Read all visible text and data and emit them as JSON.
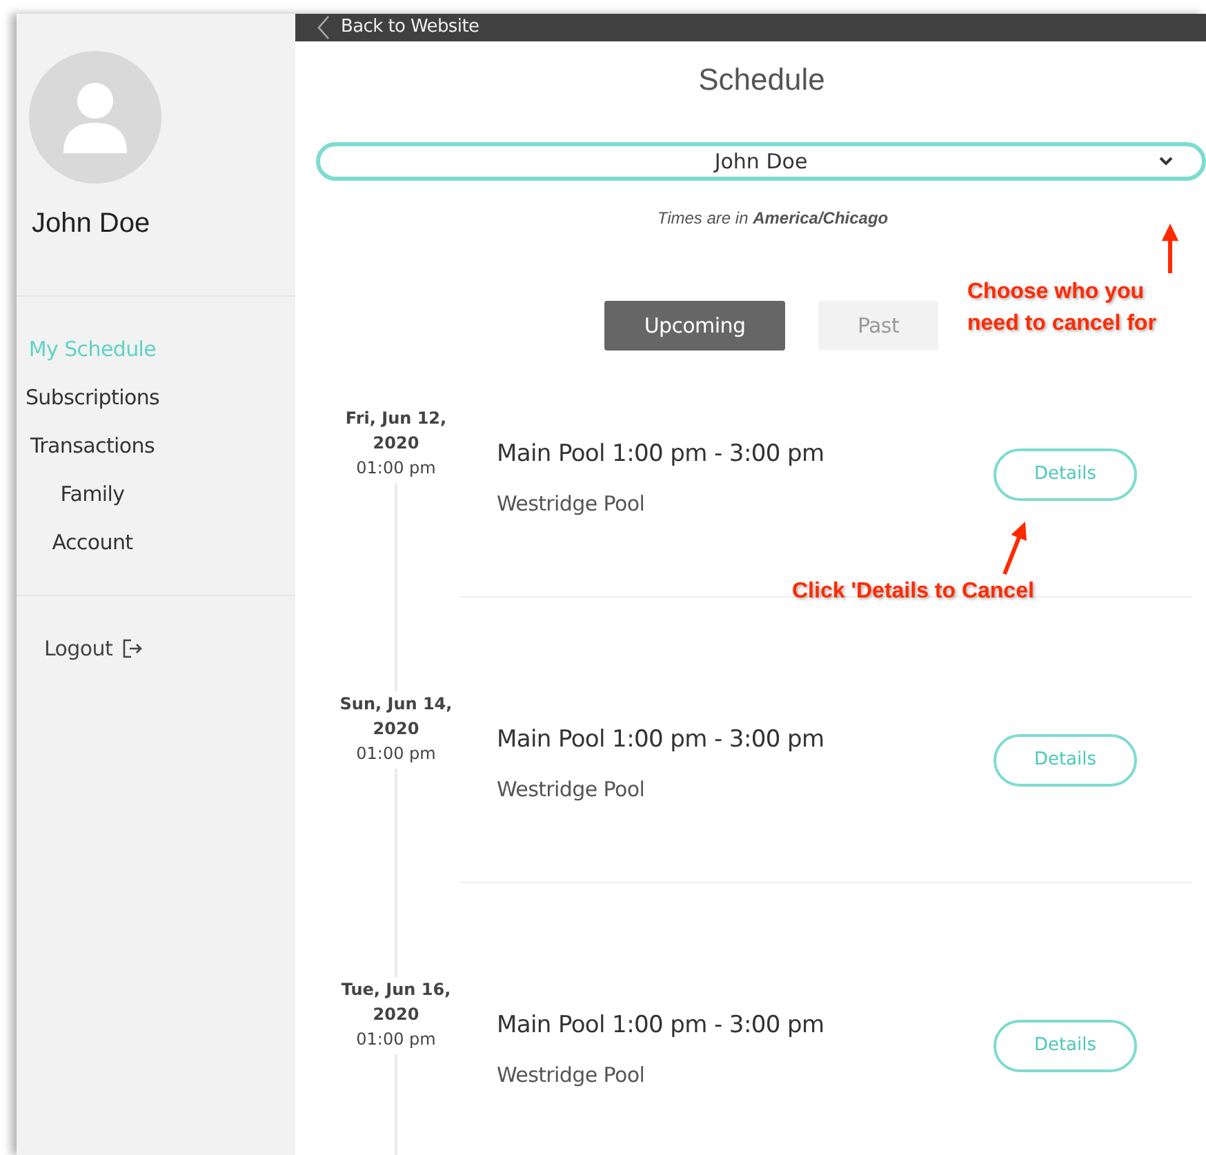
{
  "sidebar": {
    "user_name": "John Doe",
    "items": [
      {
        "label": "My Schedule",
        "selected": true
      },
      {
        "label": "Subscriptions",
        "selected": false
      },
      {
        "label": "Transactions",
        "selected": false
      },
      {
        "label": "Family",
        "selected": false
      },
      {
        "label": "Account",
        "selected": false
      }
    ],
    "logout": "Logout"
  },
  "top_bar": {
    "back_link": "Back to Website"
  },
  "page_title": "Schedule",
  "person_select": {
    "value": "John Doe"
  },
  "timezone_note": "Times are in **America/Chicago**",
  "tabs": [
    {
      "label": "Upcoming",
      "selected": true
    },
    {
      "label": "Past",
      "selected": false
    }
  ],
  "events": [
    {
      "date": "Fri, Jun 12,",
      "year": "2020",
      "time": "01:00 pm",
      "title": "Main Pool 1:00 pm - 3:00 pm",
      "location": "Westridge Pool",
      "button": "Details"
    },
    {
      "date": "Sun, Jun 14,",
      "year": "2020",
      "time": "01:00 pm",
      "title": "Main Pool 1:00 pm - 3:00 pm",
      "location": "Westridge Pool",
      "button": "Details"
    },
    {
      "date": "Tue, Jun 16,",
      "year": "2020",
      "time": "01:00 pm",
      "title": "Main Pool 1:00 pm - 3:00 pm",
      "location": "Westridge Pool",
      "button": "Details"
    }
  ],
  "annotations": [
    {
      "kind": "select",
      "text": "Choose who you need to cancel for"
    },
    {
      "kind": "details",
      "text": "Click 'Details to Cancel"
    }
  ]
}
